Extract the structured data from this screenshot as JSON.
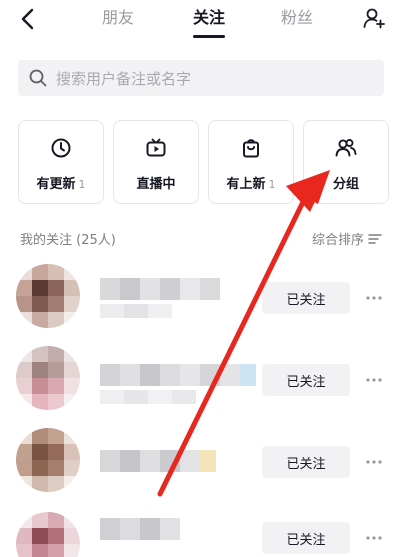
{
  "nav": {
    "tabs": [
      {
        "label": "朋友",
        "active": false
      },
      {
        "label": "关注",
        "active": true
      },
      {
        "label": "粉丝",
        "active": false
      }
    ]
  },
  "search": {
    "placeholder": "搜索用户备注或名字"
  },
  "cards": [
    {
      "label": "有更新",
      "badge": "1",
      "icon": "clock-icon"
    },
    {
      "label": "直播中",
      "badge": "",
      "icon": "tv-icon"
    },
    {
      "label": "有上新",
      "badge": "1",
      "icon": "shopping-bag-icon"
    },
    {
      "label": "分组",
      "badge": "",
      "icon": "group-icon"
    }
  ],
  "section": {
    "title": "我的关注 (25人)",
    "sort_label": "综合排序"
  },
  "follow_rows": [
    {
      "button_label": "已关注"
    },
    {
      "button_label": "已关注"
    },
    {
      "button_label": "已关注"
    },
    {
      "button_label": "已关注"
    }
  ],
  "colors": {
    "text": "#161823",
    "muted": "#9a9ba1",
    "button_bg": "#f2f2f4",
    "annotation_arrow": "#e8271f"
  }
}
